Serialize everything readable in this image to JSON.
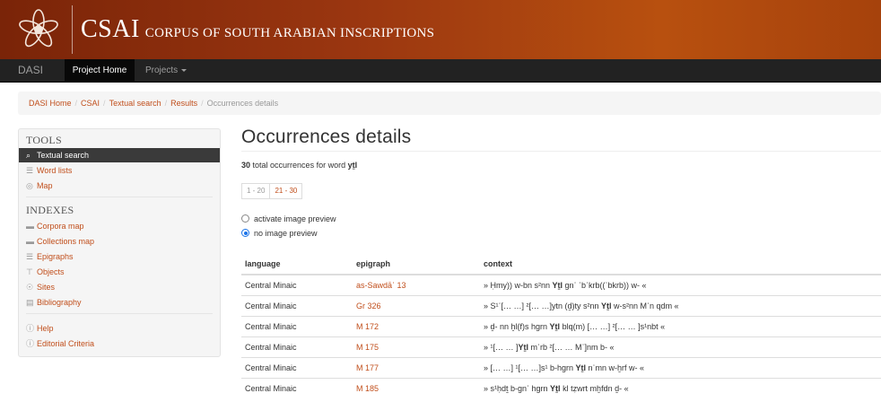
{
  "header": {
    "acronym": "CSAI",
    "full_name": "CORPUS OF SOUTH ARABIAN INSCRIPTIONS",
    "colors": {
      "banner_start": "#7a2408",
      "banner_end": "#b8500f",
      "accent": "#c14f1c"
    }
  },
  "nav": {
    "brand": "DASI",
    "items": [
      {
        "label": "Project Home",
        "active": true
      },
      {
        "label": "Projects",
        "dropdown": true
      }
    ]
  },
  "breadcrumb": {
    "items": [
      "DASI Home",
      "CSAI",
      "Textual search",
      "Results"
    ],
    "current": "Occurrences details"
  },
  "sidebar": {
    "tools_heading": "TOOLS",
    "tools": [
      {
        "label": "Textual search",
        "icon": "search-icon",
        "active": true
      },
      {
        "label": "Word lists",
        "icon": "list-icon"
      },
      {
        "label": "Map",
        "icon": "globe-icon"
      }
    ],
    "indexes_heading": "INDEXES",
    "indexes": [
      {
        "label": "Corpora map",
        "icon": "folder-icon"
      },
      {
        "label": "Collections map",
        "icon": "folder-icon"
      },
      {
        "label": "Epigraphs",
        "icon": "list-icon"
      },
      {
        "label": "Objects",
        "icon": "tag-icon"
      },
      {
        "label": "Sites",
        "icon": "map-marker-icon"
      },
      {
        "label": "Bibliography",
        "icon": "book-icon"
      }
    ],
    "help": [
      {
        "label": "Help",
        "icon": "question-icon"
      },
      {
        "label": "Editorial Criteria",
        "icon": "question-icon"
      }
    ]
  },
  "main": {
    "title": "Occurrences details",
    "summary": {
      "count": "30",
      "text": "total occurrences for word",
      "word": "yṯl"
    },
    "pagination": [
      "1 - 20",
      "21 - 30"
    ],
    "preview_options": [
      {
        "label": "activate image preview",
        "checked": false
      },
      {
        "label": "no image preview",
        "checked": true
      }
    ],
    "table": {
      "headers": [
        "language",
        "epigraph",
        "context"
      ],
      "rows": [
        {
          "language": "Central Minaic",
          "epigraph": "as-Sawdāʾ 13",
          "pre": "» Ḥmy)) w-bn s²nn ",
          "word": "Yṯl",
          "post": " gnʾ ʿbʾkrb((ʾbkrb)) w- «"
        },
        {
          "language": "Central Minaic",
          "epigraph": "Gr 326",
          "pre": "» S¹ʾ[… …] ²[… …]ytn (ḏ)ty s²nn ",
          "word": "Yṯl",
          "post": " w-s²nn Mʿn qdm «"
        },
        {
          "language": "Central Minaic",
          "epigraph": "M 172",
          "pre": "» ḏ- nn ḫl(f)s hgrn ",
          "word": "Yṯl",
          "post": " blq(m) [… …] ²[… … ]s¹nbt «"
        },
        {
          "language": "Central Minaic",
          "epigraph": "M 175",
          "pre": "» ¹[… … ]",
          "word": "Yṯl",
          "post": " mʿrb ²[… … Mʿ]nm b- «"
        },
        {
          "language": "Central Minaic",
          "epigraph": "M 177",
          "pre": "» [… …] ¹[… …]s¹ b-hgrn ",
          "word": "Yṯl",
          "post": " nʿmn w-ḫrf w- «"
        },
        {
          "language": "Central Minaic",
          "epigraph": "M 185",
          "pre": "» s¹ḥdṯ b-gnʾ hgrn ",
          "word": "Yṯl",
          "post": " kl tẓwrt mḫfdn ḏ- «"
        }
      ]
    }
  }
}
